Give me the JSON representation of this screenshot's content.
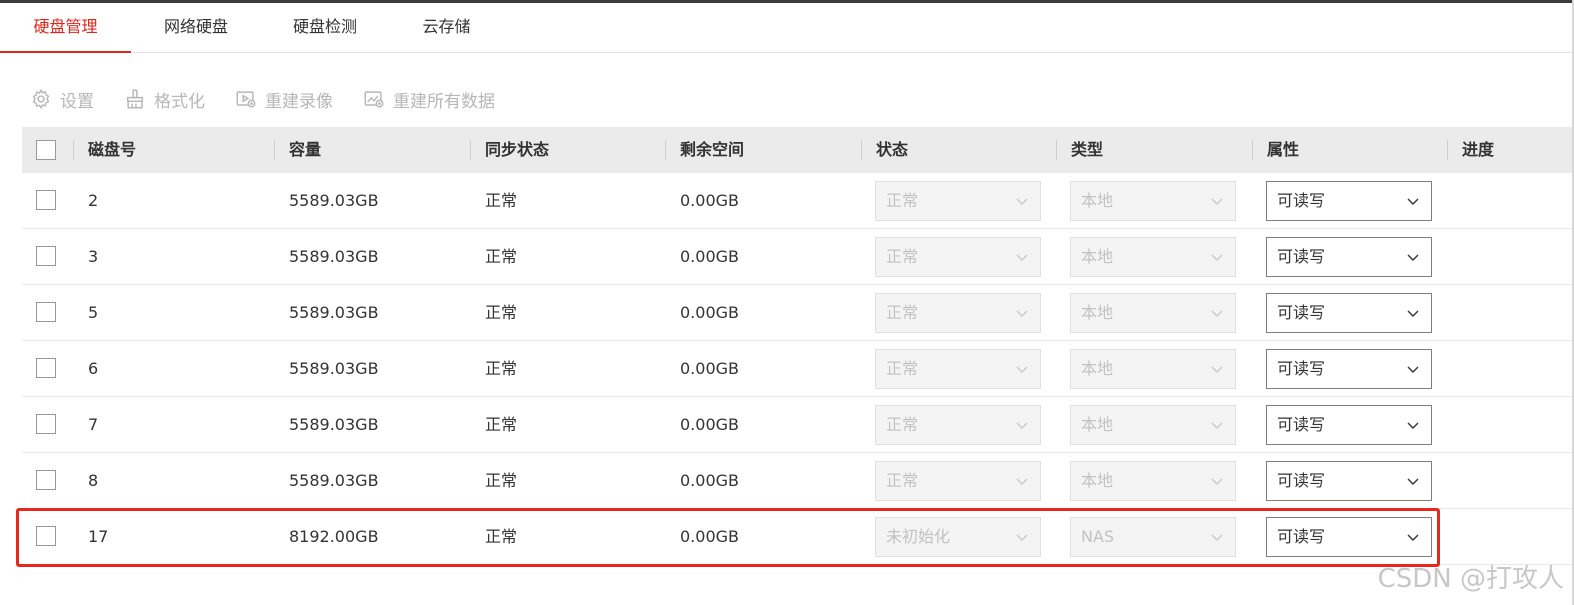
{
  "tabs": [
    {
      "label": "硬盘管理",
      "active": true
    },
    {
      "label": "网络硬盘",
      "active": false
    },
    {
      "label": "硬盘检测",
      "active": false
    },
    {
      "label": "云存储",
      "active": false
    }
  ],
  "toolbar": {
    "settings": "设置",
    "format": "格式化",
    "rebuild_record": "重建录像",
    "rebuild_all": "重建所有数据"
  },
  "table": {
    "headers": {
      "disk_no": "磁盘号",
      "capacity": "容量",
      "sync_status": "同步状态",
      "free_space": "剩余空间",
      "status": "状态",
      "type": "类型",
      "property": "属性",
      "progress": "进度"
    },
    "rows": [
      {
        "disk_no": "2",
        "capacity": "5589.03GB",
        "sync_status": "正常",
        "free_space": "0.00GB",
        "status": "正常",
        "type": "本地",
        "property": "可读写"
      },
      {
        "disk_no": "3",
        "capacity": "5589.03GB",
        "sync_status": "正常",
        "free_space": "0.00GB",
        "status": "正常",
        "type": "本地",
        "property": "可读写"
      },
      {
        "disk_no": "5",
        "capacity": "5589.03GB",
        "sync_status": "正常",
        "free_space": "0.00GB",
        "status": "正常",
        "type": "本地",
        "property": "可读写"
      },
      {
        "disk_no": "6",
        "capacity": "5589.03GB",
        "sync_status": "正常",
        "free_space": "0.00GB",
        "status": "正常",
        "type": "本地",
        "property": "可读写"
      },
      {
        "disk_no": "7",
        "capacity": "5589.03GB",
        "sync_status": "正常",
        "free_space": "0.00GB",
        "status": "正常",
        "type": "本地",
        "property": "可读写"
      },
      {
        "disk_no": "8",
        "capacity": "5589.03GB",
        "sync_status": "正常",
        "free_space": "0.00GB",
        "status": "正常",
        "type": "本地",
        "property": "可读写"
      },
      {
        "disk_no": "17",
        "capacity": "8192.00GB",
        "sync_status": "正常",
        "free_space": "0.00GB",
        "status": "未初始化",
        "type": "NAS",
        "property": "可读写"
      }
    ]
  },
  "watermark": "CSDN @打攻人",
  "colors": {
    "accent": "#e1251b",
    "highlight": "#e8271d",
    "header_bg": "#ebebeb"
  }
}
